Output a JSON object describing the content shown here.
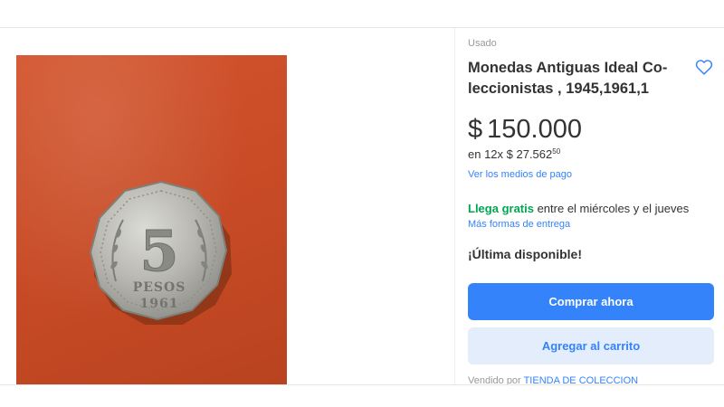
{
  "product": {
    "condition": "Usado",
    "title": "Monedas Antiguas Ideal Co- leccionistas , 1945,1961,1",
    "price_currency": "$",
    "price_amount": "150.000",
    "installments_prefix": "en 12x $ 27.562",
    "installments_cents": "50",
    "payment_methods_link": "Ver los medios de pago",
    "shipping_free": "Llega gratis",
    "shipping_rest": " entre el miércoles y el jueves",
    "shipping_link": "Más formas de entrega",
    "stock_text": "¡Última disponible!",
    "buy_now_label": "Comprar ahora",
    "add_to_cart_label": "Agregar al carrito",
    "seller_prefix": "Vendido por",
    "seller_name": "TIENDA DE COLECCION"
  },
  "photo": {
    "coin_denomination": "5",
    "coin_unit": "PESOS",
    "coin_year": "1961"
  },
  "icons": {
    "favorite": "heart-outline-icon"
  },
  "colors": {
    "accent": "#3483fa",
    "accent_light": "#e3edfb",
    "free_shipping": "#00a650",
    "background_photo": "#c84b26"
  }
}
